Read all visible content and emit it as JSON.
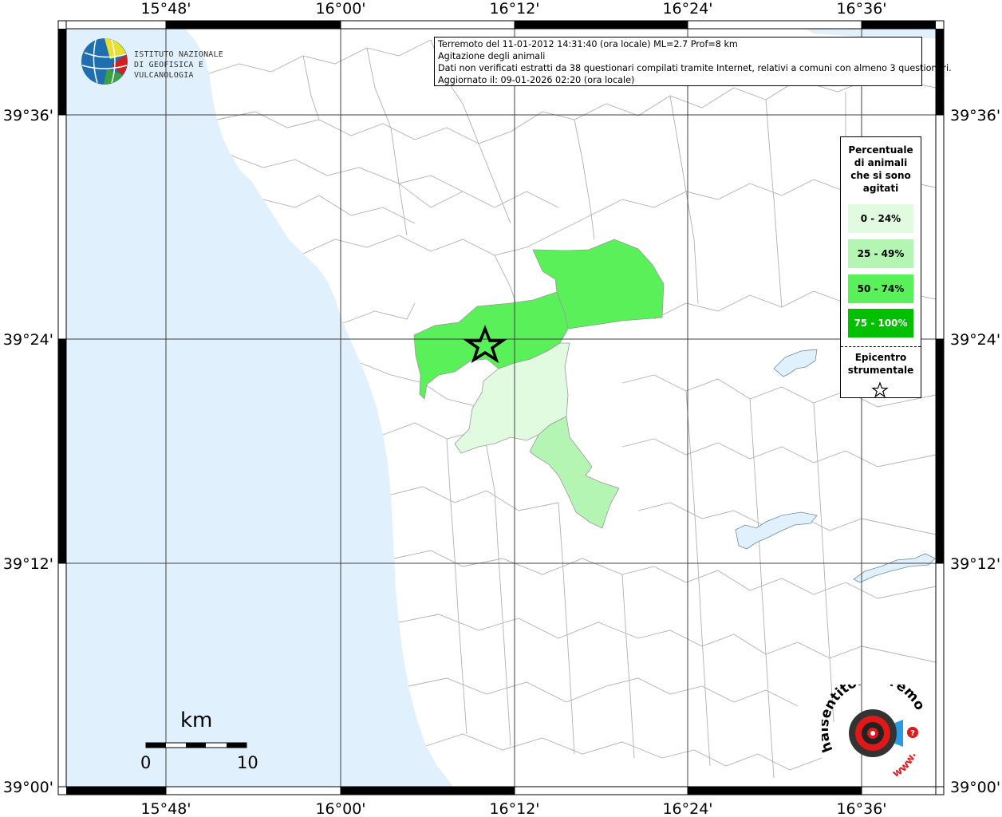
{
  "map": {
    "top_labels": [
      "15°48'",
      "16°00'",
      "16°12'",
      "16°24'",
      "16°36'"
    ],
    "bottom_labels": [
      "15°48'",
      "16°00'",
      "16°12'",
      "16°24'",
      "16°36'"
    ],
    "left_labels": [
      "39°36'",
      "39°24'",
      "39°12'",
      "39°00'"
    ],
    "right_labels": [
      "39°36'",
      "39°24'",
      "39°12'",
      "39°00'"
    ],
    "colors": {
      "sea": "#e0f0fc",
      "land": "#ffffff",
      "lake": "#e0f0fc",
      "boundary": "#9a9a9a",
      "class_0_24": "#e0fbe0",
      "class_25_49": "#b4f5b4",
      "class_50_74": "#5af05a",
      "class_75_100": "#00c000"
    }
  },
  "info": {
    "line1": "Terremoto del 11-01-2012 14:31:40 (ora locale) ML=2.7 Prof=8 km",
    "line2": "Agitazione degli animali",
    "line3": "Dati non verificati estratti da 38 questionari compilati tramite Internet, relativi a comuni con almeno 3 questionari.",
    "line4": "Aggiornato il: 09-01-2026 02:20 (ora locale)"
  },
  "logo": {
    "line1": "ISTITUTO NAZIONALE",
    "line2": "DI GEOFISICA E VULCANOLOGIA"
  },
  "legend": {
    "title": [
      "Percentuale",
      "di animali",
      "che si sono",
      "agitati"
    ],
    "classes": [
      "0 - 24%",
      "25 - 49%",
      "50 - 74%",
      "75 - 100%"
    ],
    "epicenter_label": [
      "Epicentro",
      "strumentale"
    ]
  },
  "scalebar": {
    "unit": "km",
    "start": "0",
    "end": "10"
  },
  "watermark": {
    "text": "haisentitoilterremoto.it",
    "url": "www.",
    "icon": "target-speaker-icon"
  }
}
